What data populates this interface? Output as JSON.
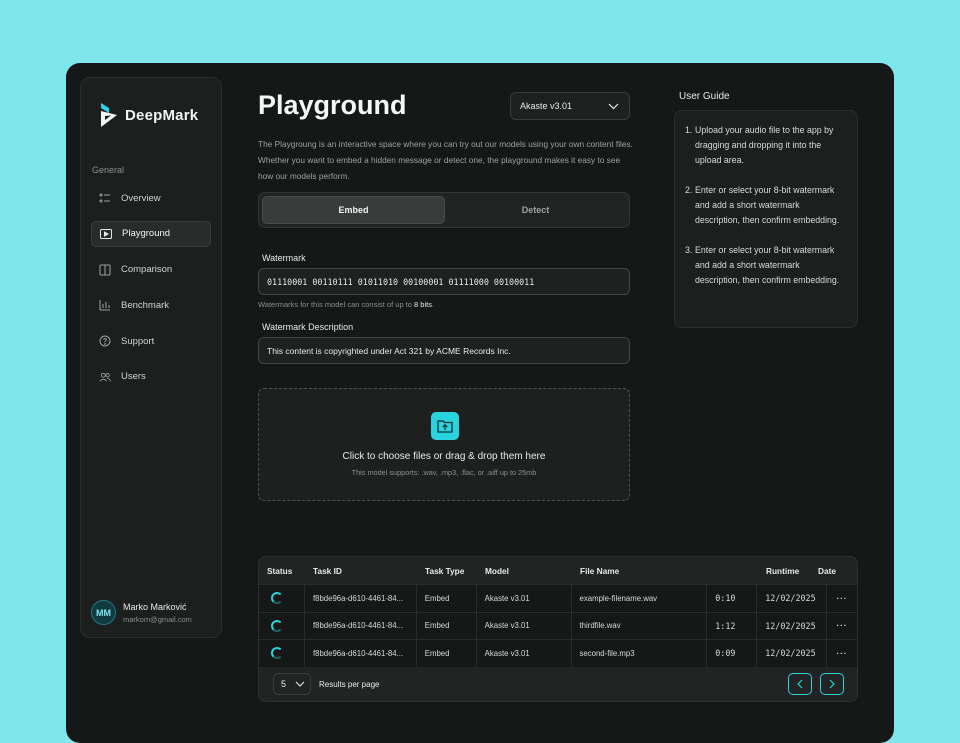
{
  "app": {
    "brand": "DeepMark"
  },
  "sidebar": {
    "section": "General",
    "items": [
      {
        "label": "Overview",
        "icon": "list-icon",
        "active": false
      },
      {
        "label": "Playground",
        "icon": "play-icon",
        "active": true
      },
      {
        "label": "Comparison",
        "icon": "columns-icon",
        "active": false
      },
      {
        "label": "Benchmark",
        "icon": "bar-chart-icon",
        "active": false
      },
      {
        "label": "Support",
        "icon": "help-icon",
        "active": false
      },
      {
        "label": "Users",
        "icon": "users-icon",
        "active": false
      }
    ],
    "user": {
      "initials": "MM",
      "name": "Marko Marković",
      "email": "markom@gmail.com"
    }
  },
  "main": {
    "title": "Playground",
    "model_select": "Akaste v3.01",
    "description": "The Playgroung is an interactive space where you can try out our models using your own content files. Whether you want to embed a hidden message or detect one, the playground makes it easy to see how our models perform.",
    "tabs": [
      {
        "label": "Embed",
        "active": true
      },
      {
        "label": "Detect",
        "active": false
      }
    ],
    "watermark_label": "Watermark",
    "watermark_value": "01110001 00110111 01011010 00100001 01111000 00100011",
    "hint_pre": "Watermarks for this model can consist of up to ",
    "hint_bits": "8 bits",
    "hint_post": ".",
    "desc_label": "Watermark Description",
    "desc_value": "This content is copyrighted under Act 321 by ACME Records Inc.",
    "dropzone": {
      "main": "Click to choose files or drag & drop them here",
      "sub": "This model supports: .wav, .mp3, .flac, or .aiff up to 25mb"
    }
  },
  "guide": {
    "title": "User Guide",
    "steps": [
      "Upload your audio file to the app by dragging and dropping it into the upload area.",
      "Enter or select your 8-bit watermark and add a short watermark description, then confirm embedding.",
      "Enter or select your 8-bit watermark and add a short watermark description, then confirm embedding."
    ]
  },
  "table": {
    "headers": [
      "Status",
      "Task ID",
      "Task Type",
      "Model",
      "File Name",
      "Runtime",
      "Date"
    ],
    "rows": [
      {
        "task_id": "f8bde96a-d610-4461-84...",
        "type": "Embed",
        "model": "Akaste v3.01",
        "file": "example-filename.wav",
        "runtime": "0:10",
        "date": "12/02/2025"
      },
      {
        "task_id": "f8bde96a-d610-4461-84...",
        "type": "Embed",
        "model": "Akaste v3.01",
        "file": "thirdfile.wav",
        "runtime": "1:12",
        "date": "12/02/2025"
      },
      {
        "task_id": "f8bde96a-d610-4461-84...",
        "type": "Embed",
        "model": "Akaste v3.01",
        "file": "second-file.mp3",
        "runtime": "0:09",
        "date": "12/02/2025"
      }
    ],
    "per_page_value": "5",
    "per_page_label": "Results per page",
    "more": "···"
  },
  "colors": {
    "accent": "#2ad4de",
    "background": "#7fe7ec",
    "panel": "#161717"
  }
}
